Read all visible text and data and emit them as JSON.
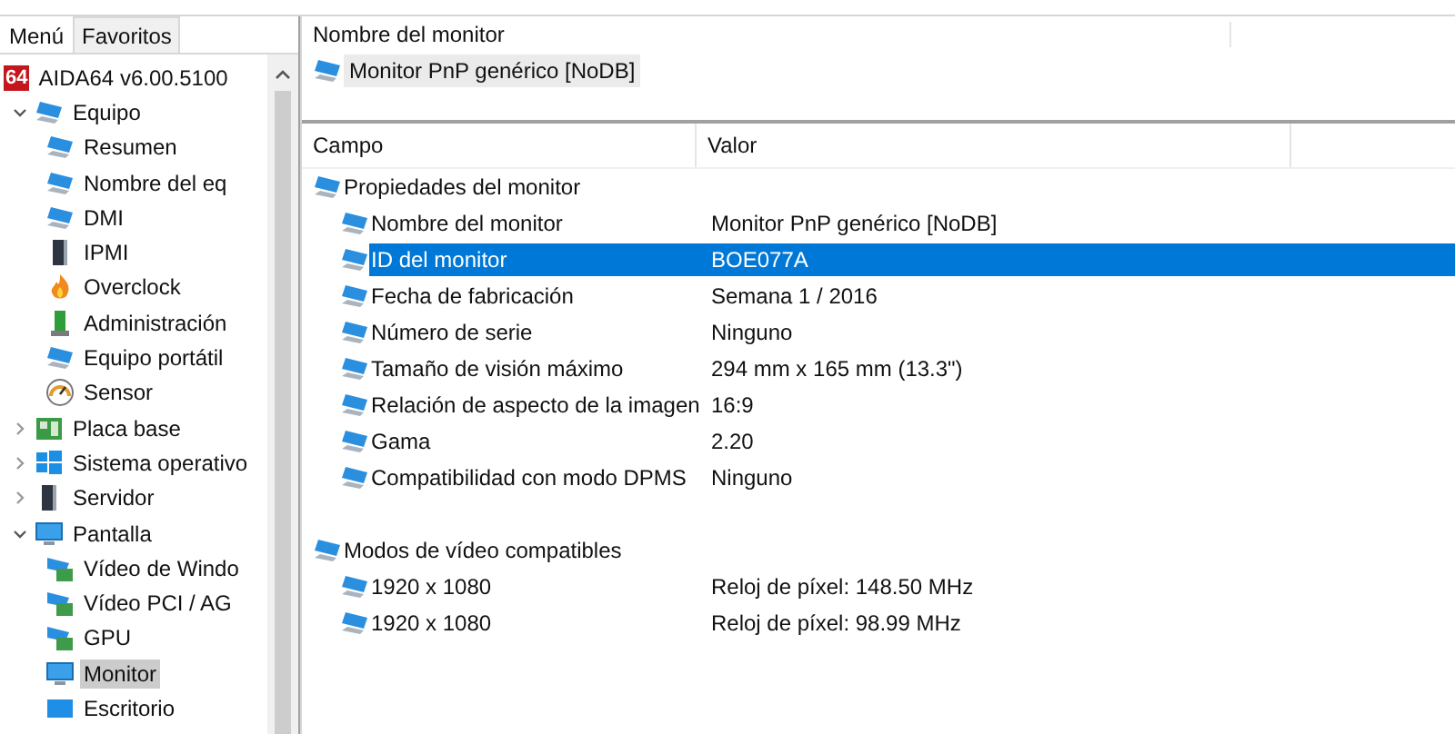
{
  "tabs": [
    {
      "label": "Menú",
      "selected": true
    },
    {
      "label": "Favoritos",
      "selected": false
    }
  ],
  "tree": [
    {
      "label": "AIDA64 v6.00.5100",
      "kind": "logo",
      "logo": "64",
      "selected": false
    },
    {
      "label": "Equipo",
      "kind": "computer",
      "expanded": true,
      "selected": false,
      "children": [
        {
          "label": "Resumen",
          "kind": "computer",
          "selected": false
        },
        {
          "label": "Nombre del eq",
          "kind": "computer",
          "selected": false
        },
        {
          "label": "DMI",
          "kind": "computer",
          "selected": false
        },
        {
          "label": "IPMI",
          "kind": "server",
          "selected": false
        },
        {
          "label": "Overclock",
          "kind": "flame",
          "selected": false
        },
        {
          "label": "Administración",
          "kind": "admin",
          "selected": false
        },
        {
          "label": "Equipo portátil",
          "kind": "computer",
          "selected": false
        },
        {
          "label": "Sensor",
          "kind": "gauge",
          "selected": false
        }
      ]
    },
    {
      "label": "Placa base",
      "kind": "board",
      "expanded": false,
      "selected": false
    },
    {
      "label": "Sistema operativo",
      "kind": "windows",
      "expanded": false,
      "selected": false
    },
    {
      "label": "Servidor",
      "kind": "server",
      "expanded": false,
      "selected": false
    },
    {
      "label": "Pantalla",
      "kind": "display",
      "expanded": true,
      "selected": false,
      "children": [
        {
          "label": "Vídeo de Windo",
          "kind": "card",
          "selected": false
        },
        {
          "label": "Vídeo PCI / AG",
          "kind": "card",
          "selected": false
        },
        {
          "label": "GPU",
          "kind": "card",
          "selected": false
        },
        {
          "label": "Monitor",
          "kind": "display",
          "selected": true
        },
        {
          "label": "Escritorio",
          "kind": "desktop",
          "selected": false
        }
      ]
    }
  ],
  "device_list": {
    "header": "Nombre del monitor",
    "items": [
      {
        "label": "Monitor PnP genérico [NoDB]",
        "selected": true
      }
    ]
  },
  "details": {
    "columns": [
      "Campo",
      "Valor"
    ],
    "groups": [
      {
        "label": "Propiedades del monitor",
        "rows": [
          {
            "field": "Nombre del monitor",
            "value": "Monitor PnP genérico [NoDB]",
            "selected": false
          },
          {
            "field": "ID del monitor",
            "value": "BOE077A",
            "selected": true
          },
          {
            "field": "Fecha de fabricación",
            "value": "Semana 1 / 2016",
            "selected": false
          },
          {
            "field": "Número de serie",
            "value": "Ninguno",
            "selected": false
          },
          {
            "field": "Tamaño de visión máximo",
            "value": "294 mm x 165 mm (13.3\")",
            "selected": false
          },
          {
            "field": "Relación de aspecto de la imagen",
            "value": "16:9",
            "selected": false
          },
          {
            "field": "Gama",
            "value": "2.20",
            "selected": false
          },
          {
            "field": "Compatibilidad con modo DPMS",
            "value": "Ninguno",
            "selected": false
          }
        ]
      },
      {
        "label": "Modos de vídeo compatibles",
        "rows": [
          {
            "field": "1920 x 1080",
            "value": "Reloj de píxel: 148.50 MHz",
            "selected": false
          },
          {
            "field": "1920 x 1080",
            "value": "Reloj de píxel: 98.99 MHz",
            "selected": false
          }
        ]
      }
    ]
  }
}
